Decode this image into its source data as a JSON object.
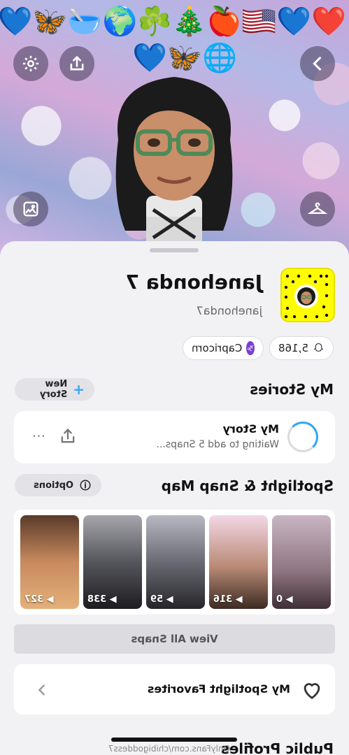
{
  "header": {
    "emoji_row_1": [
      "❤️",
      "💙",
      "🇺🇸",
      "🍎",
      "🎄",
      "☘️",
      "🌍",
      "🥣",
      "🦋",
      "💙"
    ],
    "emoji_row_2": [
      "🌐",
      "🦋",
      "💙"
    ],
    "icons": [
      "settings-icon",
      "share-icon",
      "chevron-right-icon",
      "wallpaper-icon",
      "hanger-icon"
    ]
  },
  "profile": {
    "display_name": "Janehonda 7",
    "username": "janehonda7",
    "snap_score": "5,168",
    "zodiac": "Capricorn",
    "zodiac_glyph": "♑"
  },
  "my_stories": {
    "title": "My Stories",
    "new_story_label": "New Story",
    "story_title": "My Story",
    "story_subtitle": "Waiting to add 5 Snaps...",
    "more_label": "···"
  },
  "spotlight": {
    "title": "Spotlight & Snap Map",
    "options_label": "Options",
    "thumbnails": [
      {
        "count": "0"
      },
      {
        "count": "316"
      },
      {
        "count": "59"
      },
      {
        "count": "338"
      },
      {
        "count": "327"
      }
    ],
    "view_all_label": "View All Snaps"
  },
  "favorites": {
    "label": "My Spotlight Favorites"
  },
  "public_profiles": {
    "title": "Public Profiles"
  },
  "watermark": "OnlyFans.com/chibigoddess7",
  "colors": {
    "snapcode_yellow": "#fffc00",
    "accent_blue": "#2fa8f5",
    "zodiac_purple": "#7a3fd1"
  }
}
